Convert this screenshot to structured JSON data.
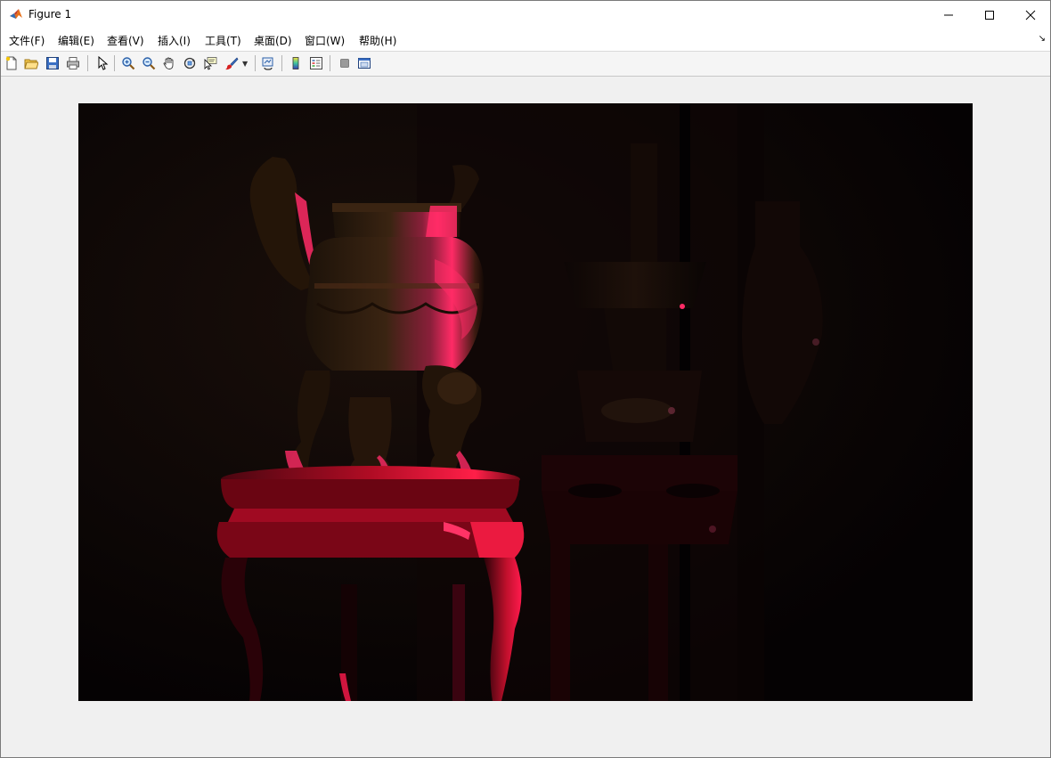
{
  "window": {
    "title": "Figure 1",
    "app_icon": "matlab-icon",
    "controls": [
      "minimize-icon",
      "maximize-icon",
      "close-icon"
    ]
  },
  "menubar": {
    "items": [
      {
        "label": "文件(F)"
      },
      {
        "label": "编辑(E)"
      },
      {
        "label": "查看(V)"
      },
      {
        "label": "插入(I)"
      },
      {
        "label": "工具(T)"
      },
      {
        "label": "桌面(D)"
      },
      {
        "label": "窗口(W)"
      },
      {
        "label": "帮助(H)"
      }
    ]
  },
  "toolbar": {
    "buttons": [
      "new-figure-icon",
      "open-file-icon",
      "save-icon",
      "print-icon",
      "edit-plot-icon",
      "zoom-in-icon",
      "zoom-out-icon",
      "pan-icon",
      "rotate-3d-icon",
      "data-cursor-icon",
      "brush-icon",
      "link-plot-icon",
      "insert-colorbar-icon",
      "insert-legend-icon",
      "hide-plot-tools-icon",
      "show-plot-tools-icon"
    ]
  },
  "figure": {
    "content": "image",
    "accent_color": "#ff1a4d"
  }
}
